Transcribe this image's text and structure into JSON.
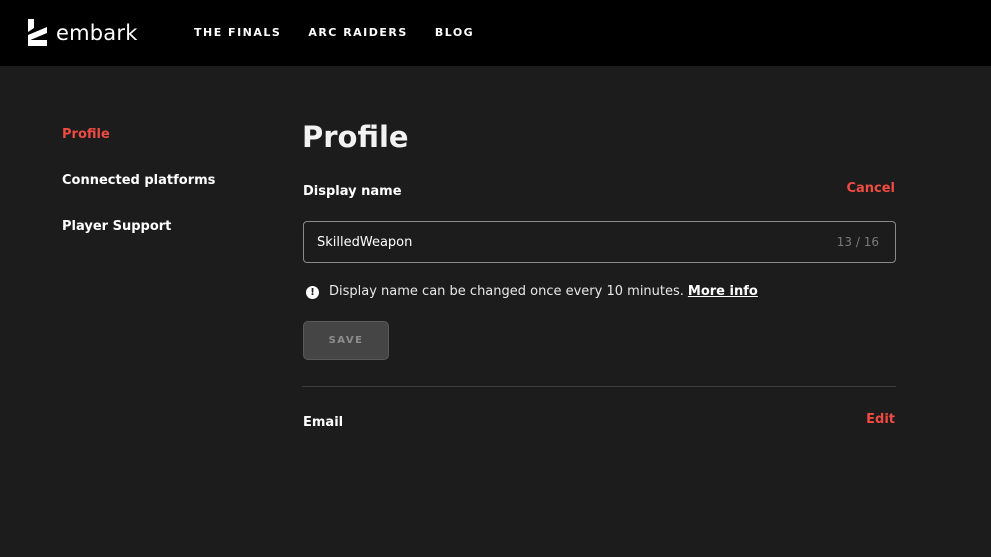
{
  "header": {
    "brand": "embark",
    "nav": [
      "THE FINALS",
      "ARC RAIDERS",
      "BLOG"
    ]
  },
  "sidebar": {
    "items": [
      {
        "label": "Profile",
        "active": true
      },
      {
        "label": "Connected platforms",
        "active": false
      },
      {
        "label": "Player Support",
        "active": false
      }
    ]
  },
  "main": {
    "title": "Profile",
    "display_name": {
      "label": "Display name",
      "action": "Cancel",
      "value": "SkilledWeapon",
      "counter": "13 / 16",
      "hint": "Display name can be changed once every 10 minutes.",
      "hint_link": "More info",
      "save_label": "SAVE"
    },
    "email": {
      "label": "Email",
      "action": "Edit"
    }
  },
  "colors": {
    "accent": "#ef4b43",
    "header_bg": "#000000",
    "page_bg": "#1c1c1c"
  },
  "icons": {
    "logo": "embark-logo-icon",
    "hint": "exclamation-circle-icon"
  }
}
